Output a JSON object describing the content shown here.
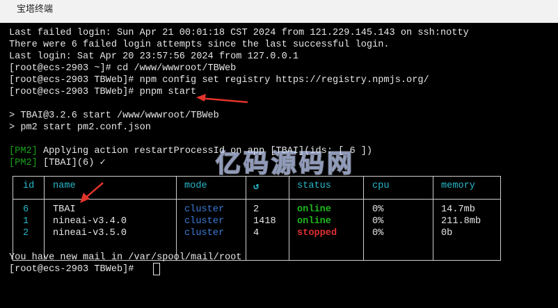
{
  "window": {
    "title": "宝塔终端"
  },
  "terminal": {
    "lines_top": [
      "Last failed login: Sun Apr 21 00:01:18 CST 2024 from 121.229.145.143 on ssh:notty",
      "There were 6 failed login attempts since the last successful login.",
      "Last login: Sat Apr 20 23:57:56 2024 from 127.0.0.1",
      "[root@ecs-2903 ~]# cd /www/wwwroot/TBWeb",
      "[root@ecs-2903 TBWeb]# npm config set registry https://registry.npmjs.org/",
      "[root@ecs-2903 TBWeb]# pnpm start"
    ],
    "lines_script": [
      "> TBAI@3.2.6 start /www/wwwroot/TBWeb",
      "> pm2 start pm2.conf.json"
    ],
    "pm2_tag": "[PM2]",
    "pm2_line1": " Applying action restartProcessId on app [TBAI](ids: [ 6 ])",
    "pm2_line2": " [TBAI](6) ✓",
    "watermark": "亿码源码网",
    "table": {
      "headers": [
        "id",
        "name",
        "mode",
        "↺",
        "status",
        "cpu",
        "memory"
      ],
      "rows": [
        {
          "id": "6",
          "name": "TBAI",
          "mode": "cluster",
          "restarts": "2",
          "status": "online",
          "cpu": "0%",
          "memory": "14.7mb"
        },
        {
          "id": "1",
          "name": "nineai-v3.4.0",
          "mode": "cluster",
          "restarts": "1418",
          "status": "online",
          "cpu": "0%",
          "memory": "211.8mb"
        },
        {
          "id": "2",
          "name": "nineai-v3.5.0",
          "mode": "cluster",
          "restarts": "4",
          "status": "stopped",
          "cpu": "0%",
          "memory": "0b"
        }
      ]
    },
    "lines_bottom": [
      "You have new mail in /var/spool/mail/root",
      "[root@ecs-2903 TBWeb]# "
    ]
  },
  "colors": {
    "online": "#1db81d",
    "stopped": "#e03030",
    "header": "#29b8c8",
    "mode": "#3a7bd5",
    "arrow": "#e2342b"
  }
}
